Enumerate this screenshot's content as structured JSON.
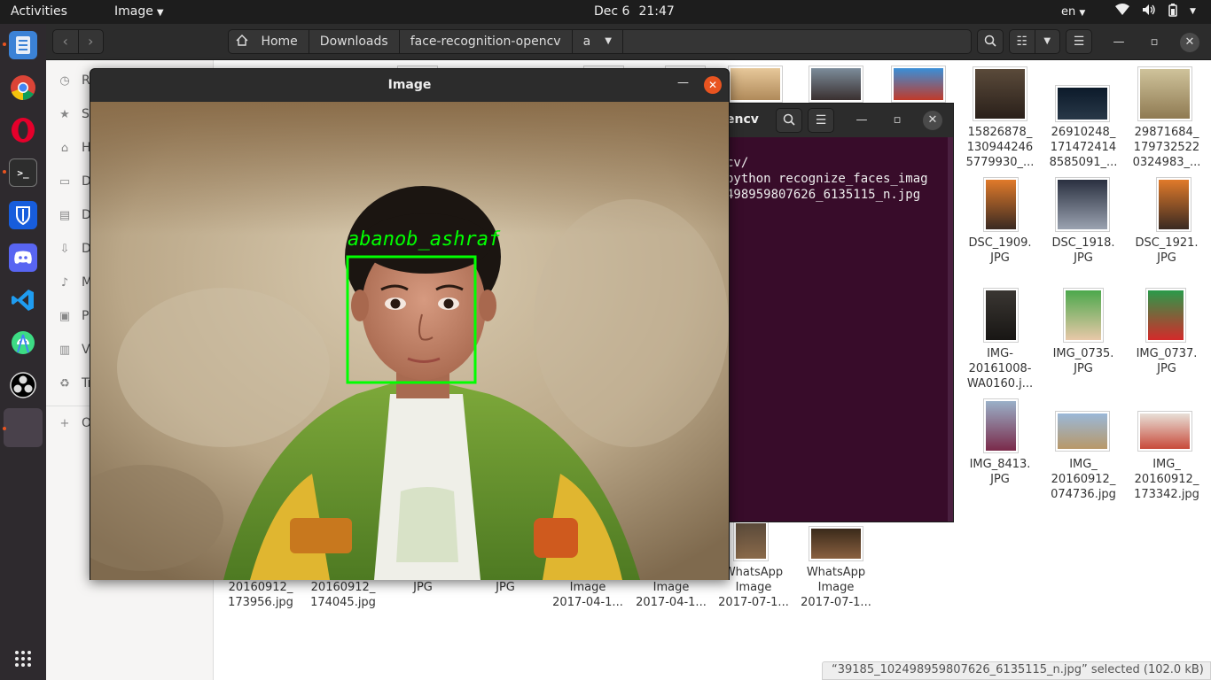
{
  "topbar": {
    "activities": "Activities",
    "app_menu": "Image",
    "date": "Dec 6",
    "time": "21:47",
    "language": "en"
  },
  "dock": {
    "items": [
      "files-icon",
      "chrome-icon",
      "opera-icon",
      "terminal-icon",
      "bitwarden-icon",
      "discord-icon",
      "vscode-icon",
      "android-studio-icon",
      "obs-icon",
      "image-viewer-icon",
      "show-apps-icon"
    ]
  },
  "file_manager": {
    "path": [
      "Home",
      "Downloads",
      "face-recognition-opencv",
      "a"
    ],
    "sidebar": [
      "Recent",
      "Starred",
      "Home",
      "Desktop",
      "Documents",
      "Downloads",
      "Music",
      "Pictures",
      "Videos",
      "Trash",
      "Other Locations"
    ],
    "sidebar_visible": [
      "Re",
      "St",
      "H",
      "De",
      "Do",
      "Do",
      "M",
      "Pi",
      "Vi",
      "Tr",
      "O"
    ],
    "files": [
      {
        "name": "15826878_\n130944246\n5779930_..."
      },
      {
        "name": "26910248_\n171472414\n8585091_..."
      },
      {
        "name": "29871684_\n179732522\n0324983_..."
      },
      {
        "name": "DSC_1909.\nJPG"
      },
      {
        "name": "DSC_1918.\nJPG"
      },
      {
        "name": "DSC_1921.\nJPG"
      },
      {
        "name": "IMG-\n20161008-\nWA0160.j..."
      },
      {
        "name": "IMG_0735.\nJPG"
      },
      {
        "name": "IMG_0737.\nJPG"
      },
      {
        "name": "IMG_8413.\nJPG"
      },
      {
        "name": "IMG_\n20160912_\n074736.jpg"
      },
      {
        "name": "IMG_\n20160912_\n173342.jpg"
      },
      {
        "name": "20160912_\n173956.jpg"
      },
      {
        "name": "20160912_\n174045.jpg"
      },
      {
        "name": "JPG"
      },
      {
        "name": "JPG"
      },
      {
        "name": "Image\n2017-04-1..."
      },
      {
        "name": "Image\n2017-04-1..."
      },
      {
        "name": "WhatsApp\nImage\n2017-07-1..."
      },
      {
        "name": "WhatsApp\nImage\n2017-07-1..."
      }
    ],
    "status": "“39185_102498959807626_6135115_n.jpg” selected  (102.0 kB)"
  },
  "terminal": {
    "title": "encv",
    "lines": [
      "cv/",
      "python recognize_faces_imag",
      "498959807626_6135115_n.jpg"
    ]
  },
  "image_window": {
    "title": "Image",
    "face_label": "abanob_ashraf",
    "colors": {
      "box": "#00ff00",
      "close": "#e95420"
    }
  }
}
